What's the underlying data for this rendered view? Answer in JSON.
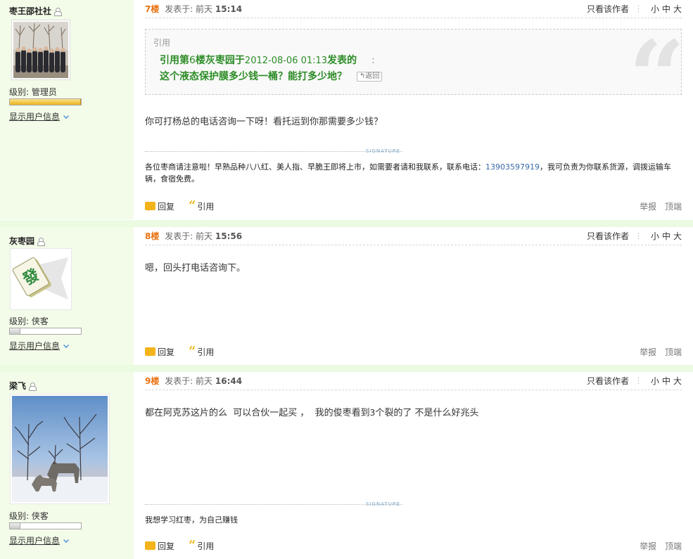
{
  "posts": [
    {
      "user": {
        "name": "枣王邵社社",
        "level_label": "级别: 管理员",
        "level_fill": 1.0,
        "show_info": "显示用户信息"
      },
      "header": {
        "floor": "7楼",
        "posted_prefix": "发表于: 前天",
        "time": "15:14",
        "only_author": "只看该作者",
        "size_small": "小",
        "size_mid": "中",
        "size_large": "大"
      },
      "quote": {
        "tag": "引用",
        "line1_a": "引用第",
        "line1_num": "6",
        "line1_b": "楼灰枣园于",
        "line1_date": "2012-08-06 01:13",
        "line1_c": "发表的",
        "line1_colon": ":",
        "line2": "这个液态保护膜多少钱一桶？能打多少地？",
        "return": "↰返回"
      },
      "message": "你可打杨总的电话咨询一下呀！看托运到你那需要多少钱？",
      "signature_label": "SIGNATURE",
      "signature_a": "各位枣商请注意啦！早熟品种八八红、美人指、早脆王即将上市，如需要者请和我联系，联系电话：",
      "signature_tel": "13903597919",
      "signature_b": "，我可负责为你联系货源，调拨运输车辆，食宿免费。",
      "actions": {
        "reply": "回复",
        "quote": "引用",
        "report": "举报",
        "top": "顶端"
      }
    },
    {
      "user": {
        "name": "灰枣园",
        "level_label": "级别: 侠客",
        "level_fill": 0.15,
        "show_info": "显示用户信息"
      },
      "header": {
        "floor": "8楼",
        "posted_prefix": "发表于: 前天",
        "time": "15:56",
        "only_author": "只看该作者",
        "size_small": "小",
        "size_mid": "中",
        "size_large": "大"
      },
      "message": "嗯，回头打电话咨询下。",
      "actions": {
        "reply": "回复",
        "quote": "引用",
        "report": "举报",
        "top": "顶端"
      }
    },
    {
      "user": {
        "name": "梁飞",
        "level_label": "级别: 侠客",
        "level_fill": 0.15,
        "show_info": "显示用户信息"
      },
      "header": {
        "floor": "9楼",
        "posted_prefix": "发表于: 前天",
        "time": "16:44",
        "only_author": "只看该作者",
        "size_small": "小",
        "size_mid": "中",
        "size_large": "大"
      },
      "message_a": "都在阿克苏这片的么  可以合伙一起买 ，  我的俊枣看到",
      "message_num": "3",
      "message_b": "个裂的了 不是什么好兆头",
      "signature_label": "SIGNATURE",
      "signature": "我想学习红枣，为自己赚钱",
      "actions": {
        "reply": "回复",
        "quote": "引用",
        "report": "举报",
        "top": "顶端"
      }
    }
  ]
}
